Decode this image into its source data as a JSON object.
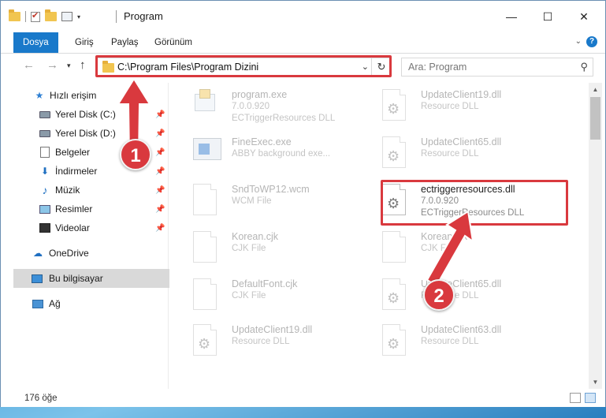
{
  "window": {
    "title": "Program",
    "minimize_glyph": "—",
    "maximize_glyph": "☐",
    "close_glyph": "✕"
  },
  "ribbon": {
    "tabs": [
      {
        "label": "Dosya",
        "active": true
      },
      {
        "label": "Giriş"
      },
      {
        "label": "Paylaş"
      },
      {
        "label": "Görünüm"
      }
    ],
    "expand_glyph": "⌄",
    "help_glyph": "?"
  },
  "nav": {
    "back_glyph": "←",
    "forward_glyph": "→",
    "recent_glyph": "▾",
    "up_glyph": "↑",
    "address": "C:\\Program Files\\Program Dizini",
    "address_dropdown_glyph": "⌄",
    "refresh_glyph": "↻",
    "search_placeholder": "Ara: Program",
    "search_glyph": "⚲"
  },
  "sidebar": {
    "items": [
      {
        "label": "Hızlı erişim",
        "icon": "star-icon",
        "glyph": "★",
        "level": 0
      },
      {
        "label": "Yerel Disk (C:)",
        "icon": "disk-icon",
        "pinned": true,
        "level": 1
      },
      {
        "label": "Yerel Disk (D:)",
        "icon": "disk-icon",
        "pinned": true,
        "level": 1
      },
      {
        "label": "Belgeler",
        "icon": "documents-icon",
        "pinned": true,
        "level": 1
      },
      {
        "label": "İndirmeler",
        "icon": "download-icon",
        "glyph": "⬇",
        "pinned": true,
        "level": 1
      },
      {
        "label": "Müzik",
        "icon": "music-icon",
        "glyph": "♪",
        "pinned": true,
        "level": 1
      },
      {
        "label": "Resimler",
        "icon": "pictures-icon",
        "pinned": true,
        "level": 1
      },
      {
        "label": "Videolar",
        "icon": "videos-icon",
        "pinned": true,
        "level": 1
      },
      {
        "label": "OneDrive",
        "icon": "cloud-icon",
        "glyph": "☁",
        "level": 0
      },
      {
        "label": "Bu bilgisayar",
        "icon": "computer-icon",
        "level": 0,
        "selected": true
      },
      {
        "label": "Ağ",
        "icon": "network-icon",
        "level": 0
      }
    ],
    "pin_glyph": "📌"
  },
  "files": [
    {
      "name": "program.exe",
      "line2": "7.0.0.920",
      "line3": "ECTriggerResources DLL",
      "icon": "exe-icon",
      "faded": true
    },
    {
      "name": "UpdateClient19.dll",
      "line2": "Resource DLL",
      "line3": "",
      "icon": "dll-icon",
      "faded": true
    },
    {
      "name": "FineExec.exe",
      "line2": "ABBY background exe...",
      "line3": "",
      "icon": "app-icon",
      "faded": true
    },
    {
      "name": "UpdateClient65.dll",
      "line2": "Resource DLL",
      "line3": "",
      "icon": "dll-icon",
      "faded": true
    },
    {
      "name": "SndToWP12.wcm",
      "line2": "WCM File",
      "line3": "",
      "icon": "blank-file-icon",
      "faded": true
    },
    {
      "name": "ectriggerresources.dll",
      "line2": "7.0.0.920",
      "line3": "ECTriggerResources DLL",
      "icon": "dll-icon",
      "faded": false
    },
    {
      "name": "Korean.cjk",
      "line2": "CJK File",
      "line3": "",
      "icon": "blank-file-icon",
      "faded": true
    },
    {
      "name": "Korean.cjk",
      "line2": "CJK File",
      "line3": "",
      "icon": "blank-file-icon",
      "faded": true
    },
    {
      "name": "DefaultFont.cjk",
      "line2": "CJK File",
      "line3": "",
      "icon": "blank-file-icon",
      "faded": true
    },
    {
      "name": "UpdateClient65.dll",
      "line2": "Resource DLL",
      "line3": "",
      "icon": "dll-icon",
      "faded": true
    },
    {
      "name": "UpdateClient19.dll",
      "line2": "Resource DLL",
      "line3": "",
      "icon": "dll-icon",
      "faded": true
    },
    {
      "name": "UpdateClient63.dll",
      "line2": "Resource DLL",
      "line3": "",
      "icon": "dll-icon",
      "faded": true
    }
  ],
  "status": {
    "count": "176 öğe"
  },
  "annotations": {
    "badge1": "1",
    "badge2": "2",
    "color": "#d9393e"
  },
  "colors": {
    "accent": "#1979ca",
    "selection": "#cce8ff",
    "highlight": "#d9393e"
  }
}
